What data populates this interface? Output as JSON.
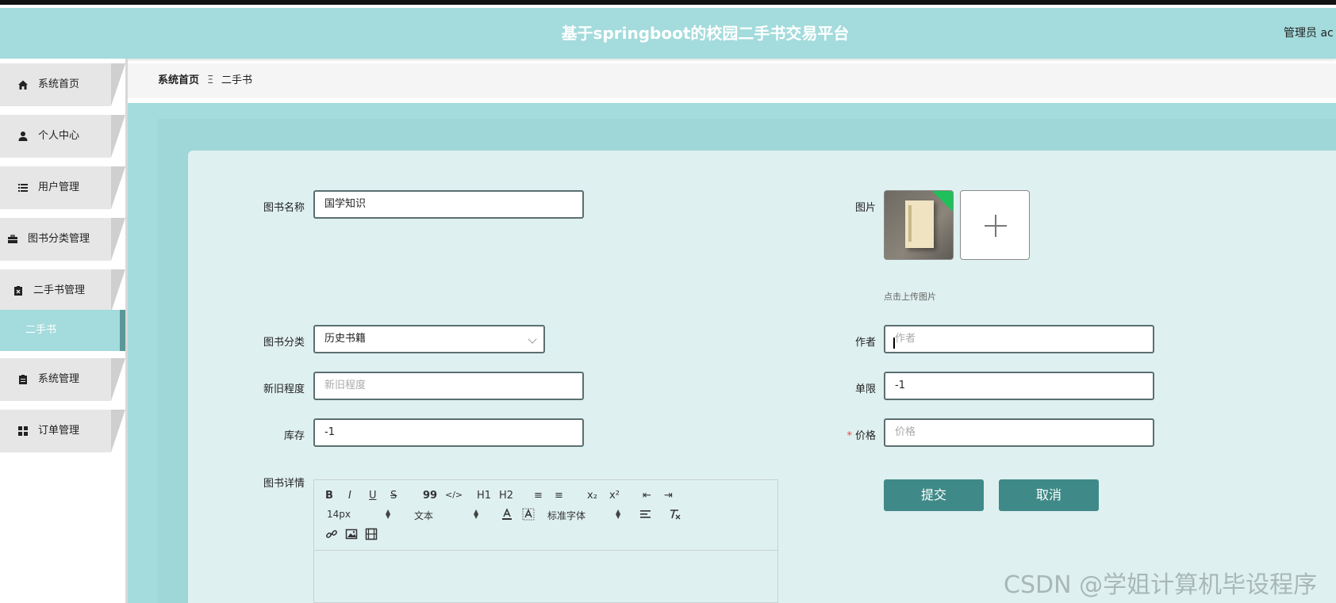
{
  "header": {
    "title": "基于springboot的校园二手书交易平台",
    "user": "管理员 ac"
  },
  "sidebar": {
    "items": [
      {
        "label": "系统首页",
        "icon": "home-icon"
      },
      {
        "label": "个人中心",
        "icon": "user-icon"
      },
      {
        "label": "用户管理",
        "icon": "list-icon"
      },
      {
        "label": "图书分类管理",
        "icon": "briefcase-icon"
      },
      {
        "label": "二手书管理",
        "icon": "clipboard-x-icon"
      },
      {
        "label": "系统管理",
        "icon": "clipboard-icon"
      },
      {
        "label": "订单管理",
        "icon": "grid-icon"
      }
    ],
    "submenu": {
      "label": "二手书"
    }
  },
  "breadcrumb": {
    "home": "系统首页",
    "separator": "Ξ",
    "current": "二手书"
  },
  "form": {
    "book_name": {
      "label": "图书名称",
      "value": "国学知识"
    },
    "image": {
      "label": "图片",
      "hint": "点击上传图片"
    },
    "category": {
      "label": "图书分类",
      "value": "历史书籍"
    },
    "author": {
      "label": "作者",
      "placeholder": "作者"
    },
    "condition": {
      "label": "新旧程度",
      "placeholder": "新旧程度"
    },
    "limit": {
      "label": "单限",
      "value": "-1"
    },
    "stock": {
      "label": "库存",
      "value": "-1"
    },
    "price": {
      "label": "价格",
      "placeholder": "价格",
      "required_mark": "*"
    },
    "details": {
      "label": "图书详情"
    },
    "submit_label": "提交",
    "cancel_label": "取消"
  },
  "editor": {
    "row1": [
      "B",
      "I",
      "U",
      "S",
      "99",
      "</>",
      "H1",
      "H2",
      "≡",
      "≡",
      "x₂",
      "x²",
      "⇤",
      "⇥"
    ],
    "size_select": "14px",
    "header_select": "文本",
    "font_select": "标准字体"
  },
  "watermark": "CSDN @学姐计算机毕设程序"
}
